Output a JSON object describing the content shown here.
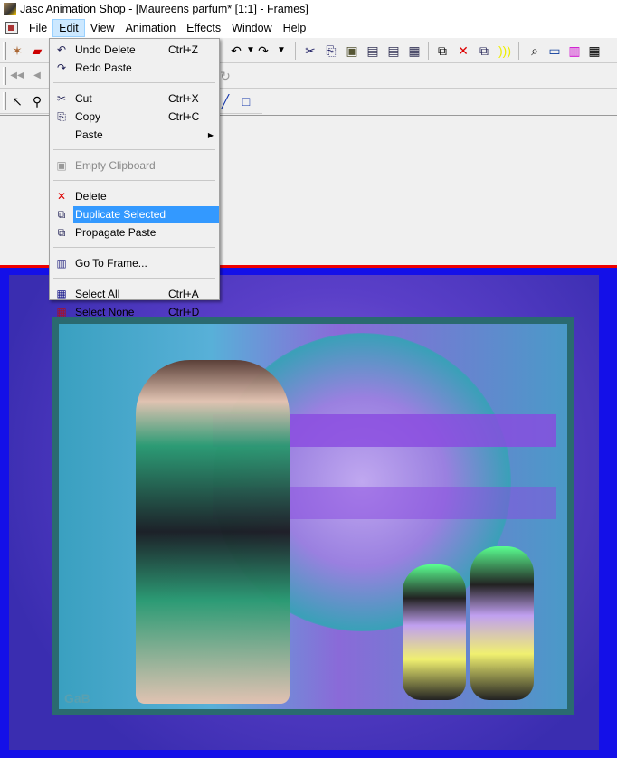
{
  "window": {
    "title": "Jasc Animation Shop - [Maureens parfum* [1:1] - Frames]"
  },
  "menubar": [
    "File",
    "Edit",
    "View",
    "Animation",
    "Effects",
    "Window",
    "Help"
  ],
  "edit_menu": [
    {
      "label": "Undo Delete",
      "shortcut": "Ctrl+Z",
      "icon": "undo-icon"
    },
    {
      "label": "Redo Paste",
      "shortcut": "",
      "icon": "redo-icon"
    },
    {
      "label": "Cut",
      "shortcut": "Ctrl+X",
      "icon": "scissors-icon"
    },
    {
      "label": "Copy",
      "shortcut": "Ctrl+C",
      "icon": "copy-icon"
    },
    {
      "label": "Paste",
      "shortcut": "",
      "icon": ""
    },
    {
      "label": "Empty Clipboard",
      "shortcut": "",
      "icon": "empty-clipboard-icon"
    },
    {
      "label": "Delete",
      "shortcut": "",
      "icon": "delete-frame-icon"
    },
    {
      "label": "Duplicate Selected",
      "shortcut": "",
      "icon": "duplicate-icon"
    },
    {
      "label": "Propagate Paste",
      "shortcut": "",
      "icon": "propagate-icon"
    },
    {
      "label": "Go To Frame...",
      "shortcut": "",
      "icon": "go-to-frame-icon"
    },
    {
      "label": "Select All",
      "shortcut": "Ctrl+A",
      "icon": "select-all-icon"
    },
    {
      "label": "Select None",
      "shortcut": "Ctrl+D",
      "icon": "select-none-icon"
    }
  ],
  "canvas": {
    "watermark": "GaB"
  },
  "colors": {
    "highlight": "#3399ff",
    "canvas_border": "#1410e8",
    "canvas_top_line": "#ee0000"
  }
}
